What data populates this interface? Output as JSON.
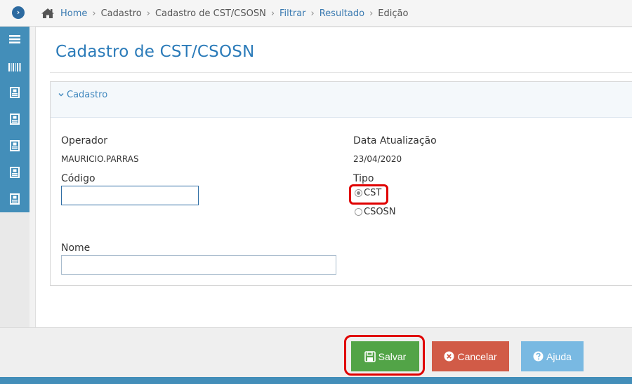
{
  "breadcrumb": {
    "items": [
      "Home",
      "Cadastro",
      "Cadastro de CST/CSOSN",
      "Filtrar",
      "Resultado",
      "Edição"
    ]
  },
  "page": {
    "title": "Cadastro de CST/CSOSN"
  },
  "panel": {
    "title": "Cadastro"
  },
  "form": {
    "operador_label": "Operador",
    "operador_value": "MAURICIO.PARRAS",
    "data_label": "Data Atualização",
    "data_value": "23/04/2020",
    "codigo_label": "Código",
    "codigo_value": "",
    "tipo_label": "Tipo",
    "tipo_options": [
      "CST",
      "CSOSN"
    ],
    "tipo_selected": "CST",
    "nome_label": "Nome",
    "nome_value": ""
  },
  "actions": {
    "salvar": "Salvar",
    "cancelar": "Cancelar",
    "ajuda": "Ajuda"
  },
  "colors": {
    "accent": "#438eb9",
    "salvar": "#52a447",
    "cancelar": "#d15b47",
    "ajuda": "#79b9e2",
    "highlight": "#e00000"
  }
}
